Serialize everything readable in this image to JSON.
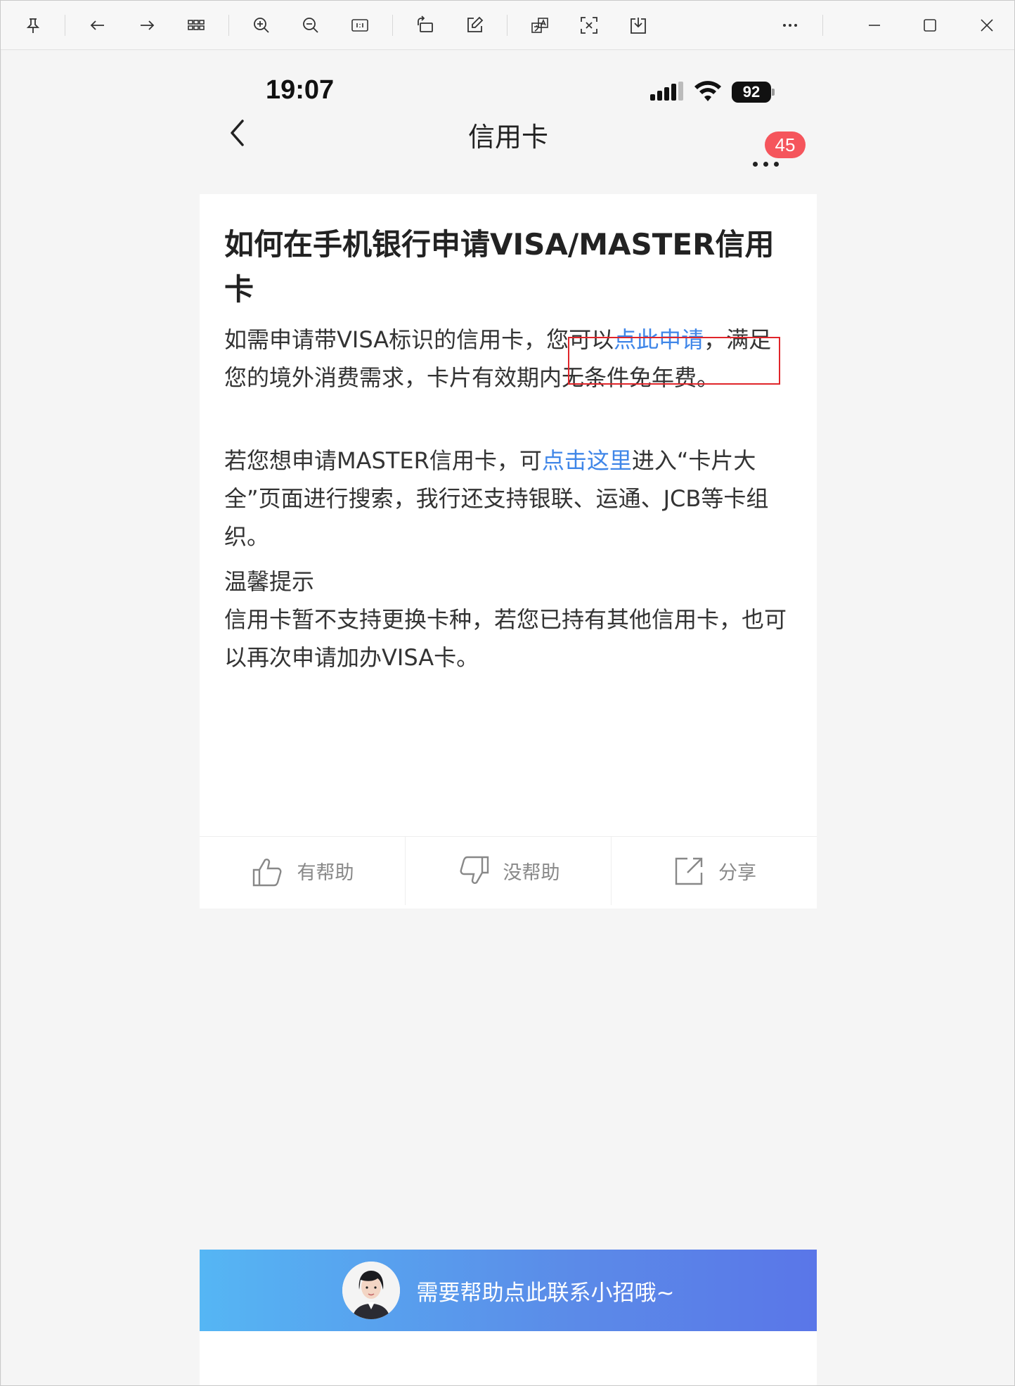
{
  "status_bar": {
    "time": "19:07",
    "battery": "92"
  },
  "nav": {
    "title": "信用卡",
    "badge_count": "45"
  },
  "article": {
    "title": "如何在手机银行申请VISA/MASTER信用卡",
    "p1_a": "如需申请带VISA标识的信用卡，",
    "p1_b": "您可以",
    "p1_link": "点此申请",
    "p1_c": "，满足您的境外消费需求，卡片有效期内无条件免年费。",
    "p2_a": "若您想申请MASTER信用卡，可",
    "p2_link": "点击这里",
    "p2_b": "进入“卡片大全”页面进行搜索，我行还支持银联、运通、JCB等卡组织。",
    "tip_title": "温馨提示",
    "tip_body": "信用卡暂不支持更换卡种，若您已持有其他信用卡，也可以再次申请加办VISA卡。"
  },
  "actions": {
    "helpful": "有帮助",
    "not_helpful": "没帮助",
    "share": "分享"
  },
  "help_banner": {
    "text": "需要帮助点此联系小招哦~"
  },
  "icons": {
    "toolbar": [
      "pin-icon",
      "arrow-left-icon",
      "arrow-right-icon",
      "grid-icon",
      "zoom-in-icon",
      "zoom-out-icon",
      "actual-size-icon",
      "rotate-icon",
      "edit-icon",
      "translate-icon",
      "ocr-icon",
      "save-icon",
      "more-icon",
      "minimize-icon",
      "maximize-icon",
      "close-icon"
    ]
  },
  "colors": {
    "link": "#3f86e8",
    "badge": "#f5555c",
    "highlight_border": "#e0252a",
    "banner_start": "#55b6f4",
    "banner_end": "#5a76e8"
  }
}
